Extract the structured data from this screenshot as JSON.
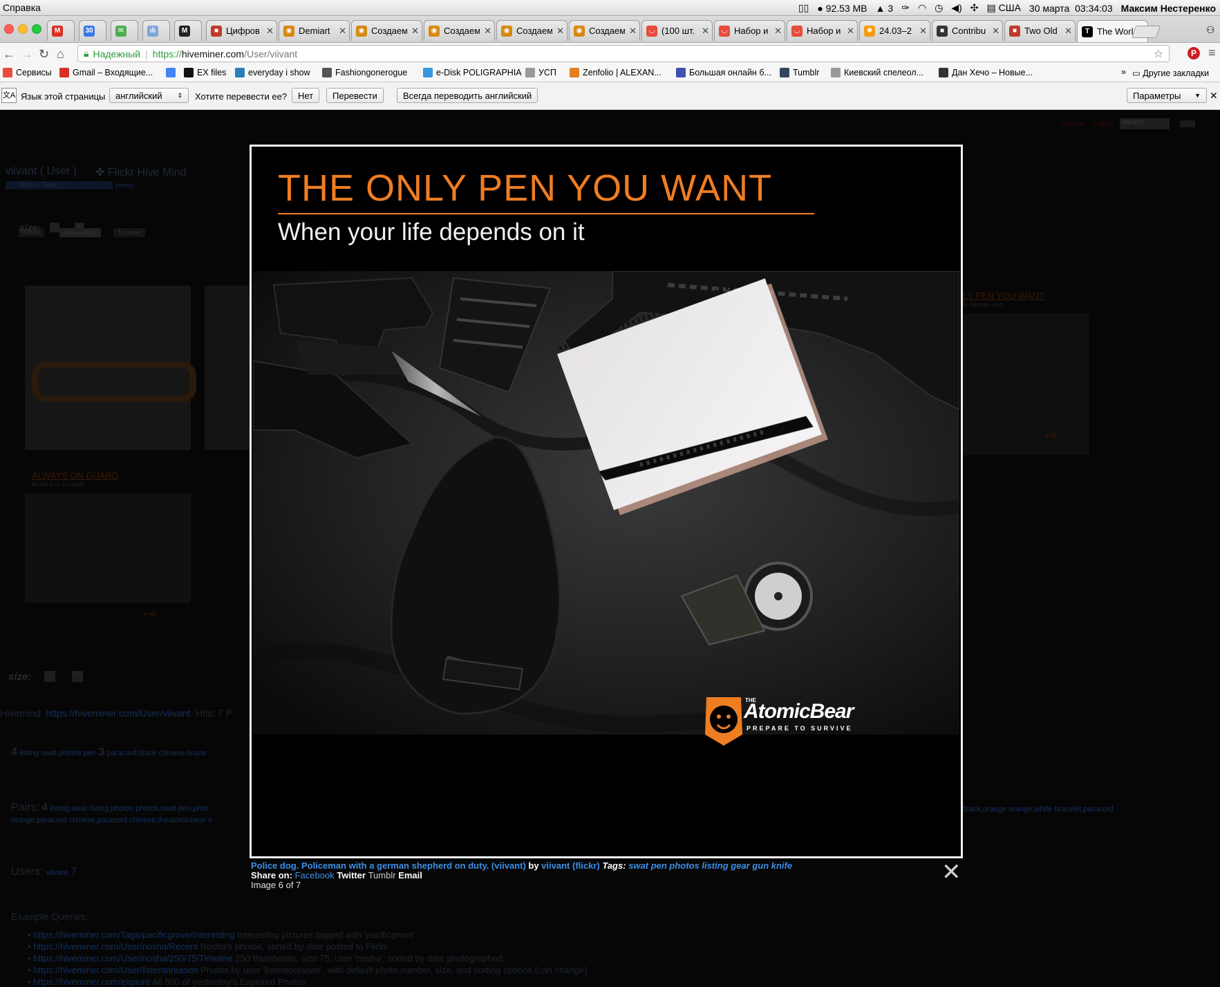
{
  "menubar": {
    "app_menu": "Справка",
    "memory": "92.53 MB",
    "adobe": "3",
    "locale": "США",
    "date": "30 марта",
    "time": "03:34:03",
    "user": "Максим Нестеренко"
  },
  "tabs": [
    {
      "label": "",
      "icon": "gmail-icon",
      "color": "#d93025",
      "glyph": "M"
    },
    {
      "label": "",
      "icon": "calendar-icon",
      "color": "#3b78e7",
      "glyph": "30"
    },
    {
      "label": "",
      "icon": "mail-icon",
      "color": "#4caf50",
      "glyph": "✉"
    },
    {
      "label": "",
      "icon": "analytics-icon",
      "color": "#7da7d9",
      "glyph": "ılı"
    },
    {
      "label": "",
      "icon": "m-icon",
      "color": "#222",
      "glyph": "M"
    },
    {
      "label": "Цифров",
      "icon": "red-box-icon",
      "color": "#c0392b",
      "glyph": "■"
    },
    {
      "label": "Demiart",
      "icon": "demiart-icon",
      "color": "#d68910",
      "glyph": "◉"
    },
    {
      "label": "Создаем",
      "icon": "demiart-icon",
      "color": "#d68910",
      "glyph": "◉"
    },
    {
      "label": "Создаем",
      "icon": "demiart-icon",
      "color": "#d68910",
      "glyph": "◉"
    },
    {
      "label": "Создаем",
      "icon": "demiart-icon",
      "color": "#d68910",
      "glyph": "◉"
    },
    {
      "label": "Создаем",
      "icon": "demiart-icon",
      "color": "#d68910",
      "glyph": "◉"
    },
    {
      "label": "(100 шт.",
      "icon": "shop-icon",
      "color": "#e74c3c",
      "glyph": "◡"
    },
    {
      "label": "Набор и",
      "icon": "shop-icon",
      "color": "#e74c3c",
      "glyph": "◡"
    },
    {
      "label": "Набор и",
      "icon": "shop-icon",
      "color": "#e74c3c",
      "glyph": "◡"
    },
    {
      "label": "24.03–2",
      "icon": "pinwheel-icon",
      "color": "#f39c12",
      "glyph": "✱"
    },
    {
      "label": "Contribu",
      "icon": "contrib-icon",
      "color": "#333",
      "glyph": "■"
    },
    {
      "label": "Two Old",
      "icon": "red-square-icon",
      "color": "#c0392b",
      "glyph": "■"
    },
    {
      "label": "The Worl",
      "icon": "nyt-icon",
      "color": "#000",
      "glyph": "T"
    }
  ],
  "address": {
    "secure_label": "Надежный",
    "scheme": "https://",
    "host": "hiveminer.com",
    "path": "/User/viivant"
  },
  "bookmarks": [
    {
      "label": "Сервисы",
      "icon": "apps-icon",
      "color": "#e74c3c"
    },
    {
      "label": "Gmail – Входящие...",
      "icon": "gmail-icon",
      "color": "#d93025"
    },
    {
      "label": "",
      "icon": "translate-icon",
      "color": "#4285f4"
    },
    {
      "label": "EX files",
      "icon": "f-icon",
      "color": "#111"
    },
    {
      "label": "everyday i show",
      "icon": "globe-icon",
      "color": "#2980b9"
    },
    {
      "label": "Fashiongonerogue",
      "icon": "fgr-icon",
      "color": "#555"
    },
    {
      "label": "e-Disk POLIGRAPHIA",
      "icon": "edisk-icon",
      "color": "#3498db"
    },
    {
      "label": "УСП",
      "icon": "page-icon",
      "color": "#999"
    },
    {
      "label": "Zenfolio | ALEXAN...",
      "icon": "zenfolio-icon",
      "color": "#e67e22"
    },
    {
      "label": "Большая онлайн б...",
      "icon": "book-icon",
      "color": "#3f51b5"
    },
    {
      "label": "Tumblr",
      "icon": "tumblr-icon",
      "color": "#35465c"
    },
    {
      "label": "Киевский спелеол...",
      "icon": "page-icon",
      "color": "#999"
    },
    {
      "label": "Дан Хечо – Новые...",
      "icon": "camera-icon",
      "color": "#333"
    }
  ],
  "bookmarks_more": "»",
  "bookmarks_other": "Другие закладки",
  "translate_bar": {
    "prompt": "Язык этой страницы",
    "language": "английский",
    "question": "Хотите перевести ее?",
    "no": "Нет",
    "translate": "Перевести",
    "always": "Всегда переводить английский",
    "options": "Параметры"
  },
  "page": {
    "top_links": {
      "explore": "Explore",
      "login": "Log In",
      "search_value": "viivant"
    },
    "heading_user": "viivant ( User )",
    "heading_hive": "Flickr Hive Mind",
    "share": "Share / Save",
    "more": "(more)",
    "tabs": [
      "Recent",
      "Interesting",
      "Timeline"
    ],
    "size_label": "size:",
    "minus": "-",
    "plus": "+",
    "thumb_title_1": "ALWAYS ON GUARD",
    "thumb_sub_1": "Be the boss be ready",
    "thumb_title_2": "LY PEN YOU WANT",
    "thumb_sub_2": "fe depends on it",
    "hivemind_label": "Hivemind:",
    "hivemind_link": "https://hiveminer.com/User/viivant",
    "hits": "Hits: 7 P",
    "tags_count_1": "4",
    "tags_1": "listing swat photos pen",
    "tags_count_2": "3",
    "tags_2": "paracord black chinese brace",
    "pairs_label": "Pairs:",
    "pairs_count": "4",
    "pairs_line1": "listing,swat listing,photos photos,swat pen,phot",
    "pairs_line1_right": "black,orange orange,white bracelet,paracord",
    "pairs_line2": "orange,paracord chinese,paracord chinese,theatomicbear o",
    "users_label": "Users:",
    "users_link": "viivant",
    "users_count": "7",
    "examples_label": "Example Queries:",
    "examples": [
      {
        "url": "https://hiveminer.com/Tags/pacificgrove/Interesting",
        "desc": "Interesting pictures tagged with 'pacificgrove'."
      },
      {
        "url": "https://hiveminer.com/User/nosha/Recent",
        "desc": "Nosha's photos, sorted by date posted to Flickr."
      },
      {
        "url": "https://hiveminer.com/User/nosha/250/75/Timeline",
        "desc": "250 thumbnails, size 75, user 'nosha', sorted by date photographed."
      },
      {
        "url": "https://hiveminer.com/User/listentoreason",
        "desc": "Photos by user 'listentoreason', with default photo number, size, and sorting options (can change)."
      },
      {
        "url": "https://hiveminer.com/explore",
        "desc": "All 500 of yesterday's Explored Photos"
      }
    ]
  },
  "lightbox": {
    "headline": "THE ONLY PEN YOU WANT",
    "subline": "When your life depends on it",
    "brand_the": "THE",
    "brand_name": "AtomicBear",
    "brand_tag": "PREPARE TO SURVIVE",
    "accent": "#ef7d22",
    "caption_title": "Police dog. Policeman with a german shepherd on duty. (viivant)",
    "caption_by": "by",
    "caption_user": "viivant (flickr)",
    "caption_tags_label": "Tags:",
    "caption_tags": "swat pen photos listing gear gun knife",
    "share_label": "Share on:",
    "share_facebook": "Facebook",
    "share_twitter": "Twitter",
    "share_tumblr": "Tumblr",
    "share_email": "Email",
    "counter": "Image 6 of 7",
    "close": "✕"
  }
}
